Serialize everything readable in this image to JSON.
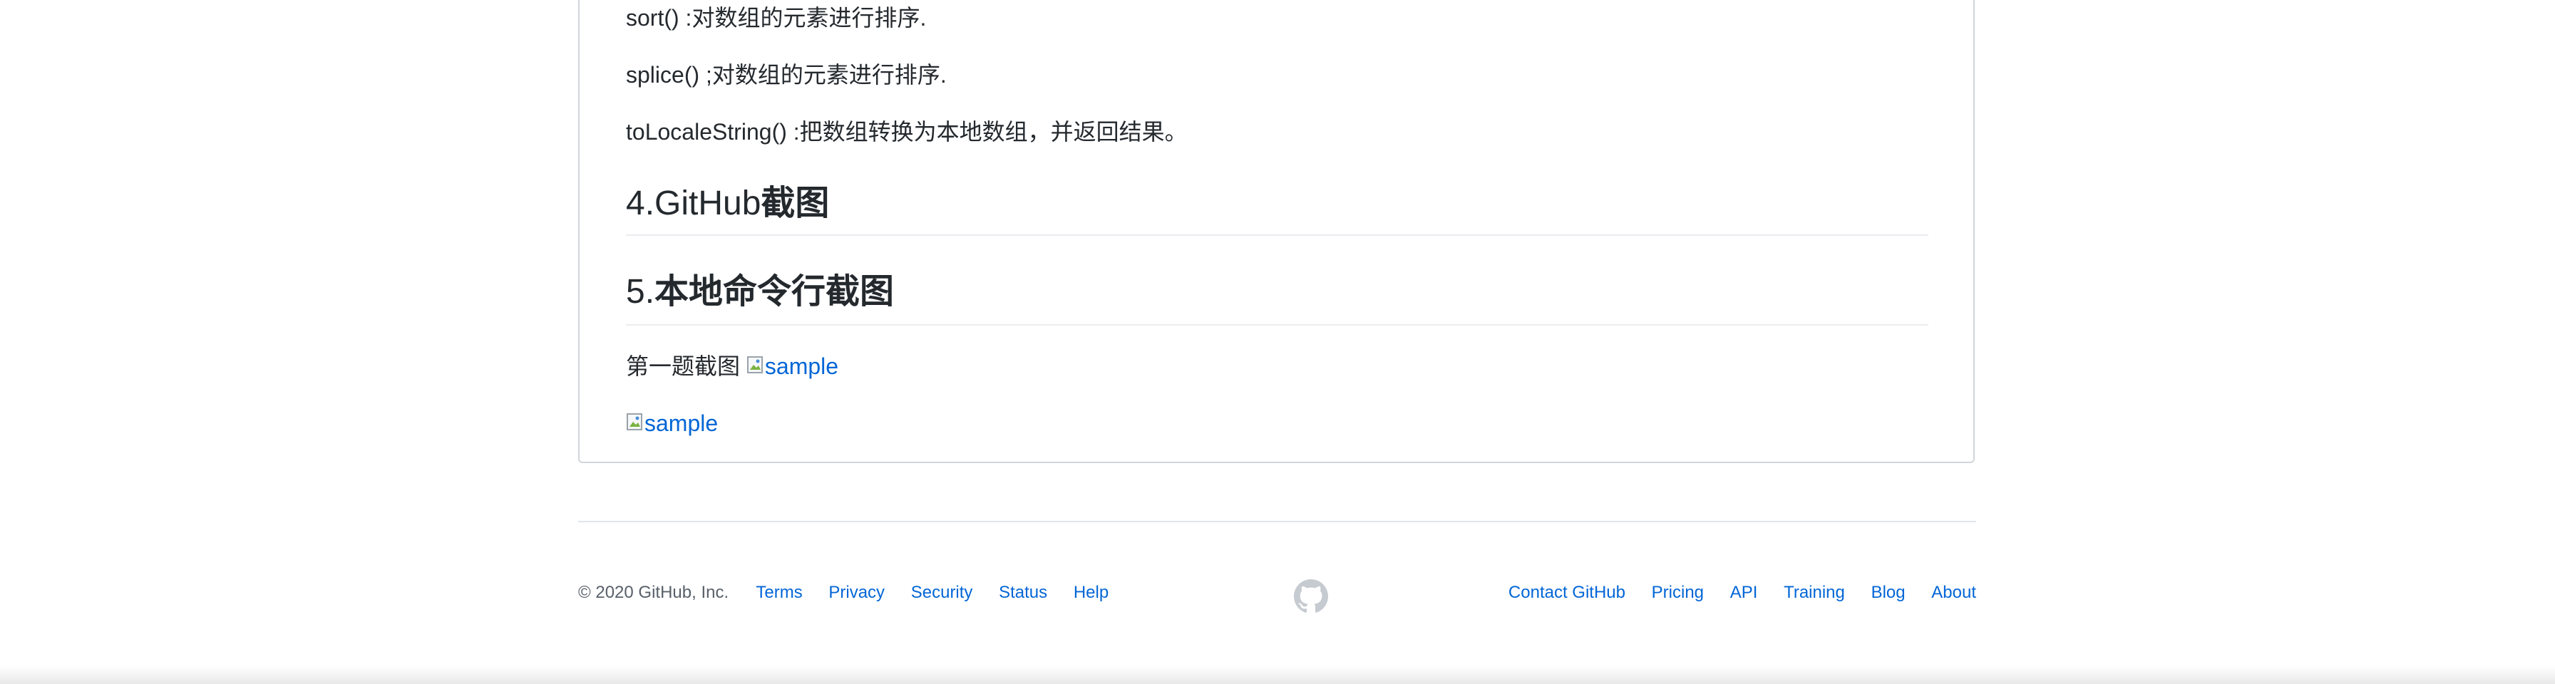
{
  "readme": {
    "lines": [
      "sort() :对数组的元素进行排序.",
      "splice() ;对数组的元素进行排序.",
      "toLocaleString() :把数组转换为本地数组，并返回结果。"
    ],
    "heading4_num": "4.",
    "heading4_ascii": "GitHub",
    "heading4_cjk": "截图",
    "heading5_num": "5.",
    "heading5_cjk": "本地命令行截图",
    "q1_label": "第一题截图",
    "image_alt_1": "sample",
    "image_alt_2": "sample"
  },
  "footer": {
    "copyright": "© 2020 GitHub, Inc.",
    "left_links": [
      "Terms",
      "Privacy",
      "Security",
      "Status",
      "Help"
    ],
    "right_links": [
      "Contact GitHub",
      "Pricing",
      "API",
      "Training",
      "Blog",
      "About"
    ]
  },
  "colors": {
    "link": "#0366d6",
    "text": "#24292e",
    "muted": "#586069",
    "border": "#d1d5da",
    "rule": "#eaecef",
    "logo": "#c6cbd1"
  },
  "icons": {
    "footer_logo": "github-mark-icon",
    "broken_image": "broken-image-icon"
  }
}
